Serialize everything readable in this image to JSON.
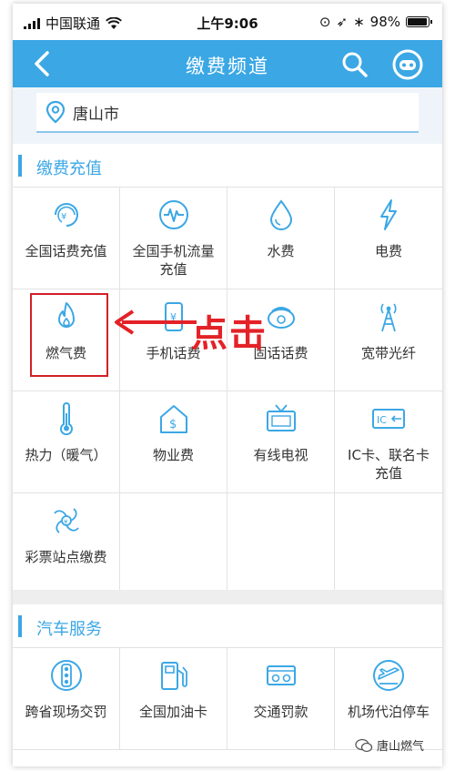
{
  "status_bar": {
    "carrier": "中国联通",
    "time": "上午9:06",
    "battery": "98%",
    "battery_level": 0.98
  },
  "navbar": {
    "title": "缴费频道",
    "back_icon": "chevron-left-icon",
    "search_icon": "search-icon",
    "assistant_icon": "robot-icon"
  },
  "location": {
    "city": "唐山市",
    "icon": "location-pin-icon"
  },
  "sections": [
    {
      "title": "缴费充值",
      "items": [
        {
          "label": "全国话费充值",
          "icon": "phone-recharge-icon"
        },
        {
          "label": "全国手机流量充值",
          "icon": "data-flow-icon"
        },
        {
          "label": "水费",
          "icon": "water-drop-icon"
        },
        {
          "label": "电费",
          "icon": "lightning-icon"
        },
        {
          "label": "燃气费",
          "icon": "flame-icon"
        },
        {
          "label": "手机话费",
          "icon": "mobile-bill-icon"
        },
        {
          "label": "固话话费",
          "icon": "landline-icon"
        },
        {
          "label": "宽带光纤",
          "icon": "broadband-tower-icon"
        },
        {
          "label": "热力（暖气）",
          "icon": "thermometer-icon"
        },
        {
          "label": "物业费",
          "icon": "property-house-icon"
        },
        {
          "label": "有线电视",
          "icon": "tv-icon"
        },
        {
          "label": "IC卡、联名卡充值",
          "icon": "ic-card-icon"
        },
        {
          "label": "彩票站点缴费",
          "icon": "lottery-icon"
        }
      ]
    },
    {
      "title": "汽车服务",
      "items": [
        {
          "label": "跨省现场交罚",
          "icon": "traffic-light-icon"
        },
        {
          "label": "全国加油卡",
          "icon": "fuel-pump-icon"
        },
        {
          "label": "交通罚款",
          "icon": "traffic-fine-icon"
        },
        {
          "label": "机场代泊停车",
          "icon": "airport-parking-icon"
        }
      ]
    }
  ],
  "annotation": {
    "text": "点击",
    "color": "#e32228"
  },
  "watermark": {
    "text": "唐山燃气"
  },
  "colors": {
    "primary": "#3ba7e5",
    "annotation_red": "#d21f26"
  }
}
